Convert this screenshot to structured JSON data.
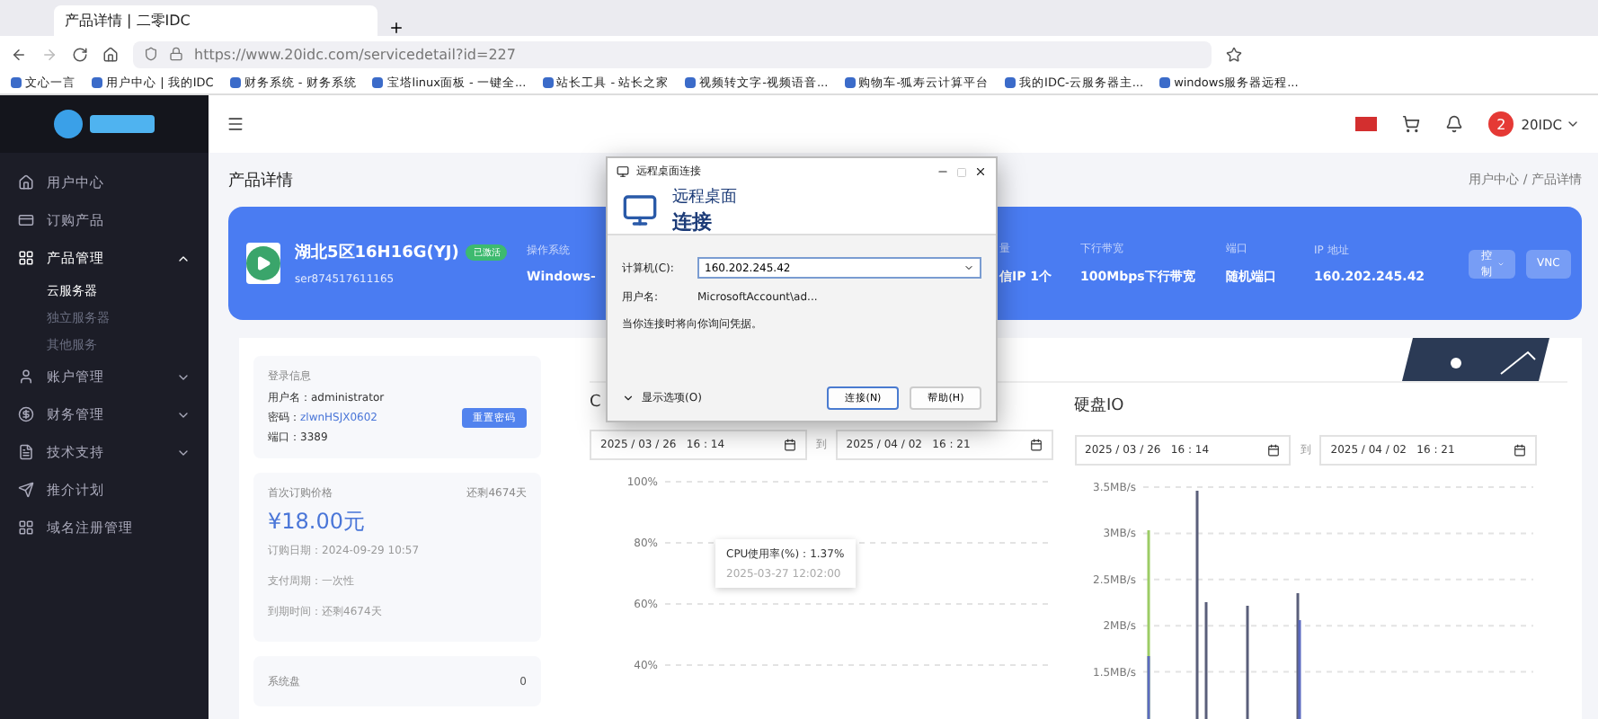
{
  "browser": {
    "tabs": [
      {
        "title": "产品详情 | 二零IDC",
        "selected": true
      }
    ],
    "url": "https://www.20idc.com/servicedetail?id=227",
    "bookmarks": [
      "文心一言",
      "用户中心 | 我的IDC",
      "财务系统 - 财务系统",
      "宝塔linux面板 - 一键全...",
      "站长工具 - 站长之家",
      "视频转文字-视频语音...",
      "购物车-狐寿云计算平台",
      "我的IDC-云服务器主...",
      "windows服务器远程..."
    ]
  },
  "sidebar": {
    "items": [
      {
        "label": "用户中心",
        "selected": false
      },
      {
        "label": "订购产品",
        "selected": false
      },
      {
        "label": "产品管理",
        "selected": false,
        "expanded": true,
        "children": [
          {
            "label": "云服务器",
            "selected": true
          },
          {
            "label": "独立服务器",
            "selected": false
          },
          {
            "label": "其他服务",
            "selected": false
          }
        ]
      },
      {
        "label": "账户管理",
        "selected": false,
        "expanded": false
      },
      {
        "label": "财务管理",
        "selected": false,
        "expanded": false
      },
      {
        "label": "技术支持",
        "selected": false,
        "expanded": false
      },
      {
        "label": "推介计划",
        "selected": false
      },
      {
        "label": "域名注册管理",
        "selected": false
      }
    ]
  },
  "header": {
    "avatar": "2",
    "user": "20IDC"
  },
  "page": {
    "title": "产品详情",
    "breadcrumb": "用户中心 / 产品详情"
  },
  "banner": {
    "name": "湖北5区16H16G(YJ)",
    "status": "已激活",
    "id": "ser874517611165",
    "fields": [
      {
        "label": "操作系统",
        "value": "Windows-"
      },
      {
        "label": "量",
        "value": "信IP 1个"
      },
      {
        "label": "下行带宽",
        "value": "100Mbps下行带宽"
      },
      {
        "label": "端口",
        "value": "随机端口"
      },
      {
        "label": "IP 地址",
        "value": "160.202.245.42"
      }
    ],
    "buttons": [
      "控制",
      "VNC"
    ]
  },
  "login": {
    "title": "登录信息",
    "rows": [
      {
        "label": "用户名：",
        "value": "administrator"
      },
      {
        "label": "密码：",
        "value": "zlwnHSJX0602"
      },
      {
        "label": "端口：",
        "value": "3389"
      }
    ],
    "button": "重置密码"
  },
  "price": {
    "title": "首次订购价格",
    "remaining": "还剩4674天",
    "amount": "¥18.00元",
    "rows": [
      "订购日期：2024-09-29 10:57",
      "支付周期：一次性",
      "到期时间：还剩4674天"
    ]
  },
  "disk": {
    "label": "系统盘",
    "value": "0"
  },
  "charts": [
    {
      "title": "C",
      "from": "2025 / 03 / 26   16 : 14",
      "to": "2025 / 04 / 02   16 : 21",
      "sep": "到",
      "tooltip": {
        "line1": "CPU使用率(%)：1.37%",
        "line2": "2025-03-27 12:02:00"
      },
      "y_labels": [
        "100%",
        "80%",
        "60%",
        "40%"
      ]
    },
    {
      "title": "硬盘IO",
      "from": "2025 / 03 / 26   16 : 14",
      "to": "2025 / 04 / 02   16 : 21",
      "sep": "到",
      "y_labels": [
        "3.5MB/s",
        "3MB/s",
        "2.5MB/s",
        "2MB/s",
        "1.5MB/s"
      ]
    }
  ],
  "dialog": {
    "title": "远程桌面连接",
    "heading1": "远程桌面",
    "heading2": "连接",
    "computer_label": "计算机(C):",
    "computer": "160.202.245.42",
    "user_label": "用户名:",
    "user": "MicrosoftAccount\\ad...",
    "note": "当你连接时将向你询问凭据。",
    "options": "显示选项(O)",
    "buttons": [
      "连接(N)",
      "帮助(H)"
    ]
  }
}
